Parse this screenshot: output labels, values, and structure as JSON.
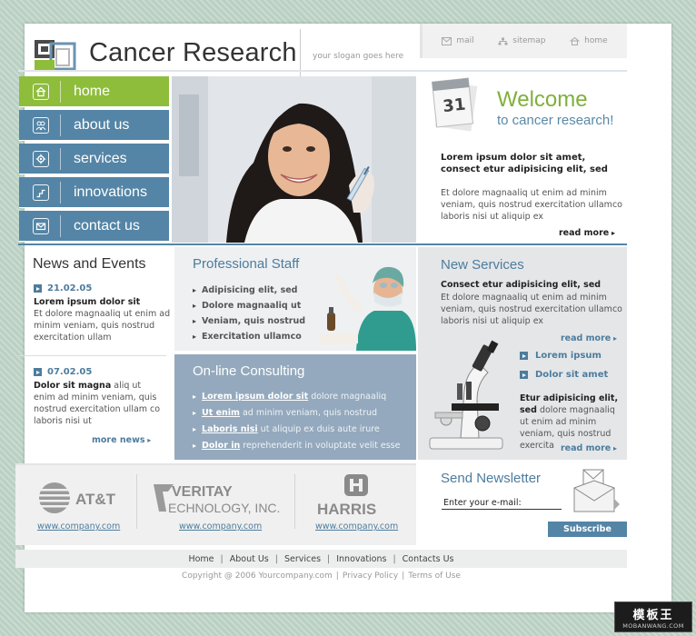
{
  "header": {
    "site_title": "Cancer Research",
    "slogan": "your slogan goes here",
    "top_links": [
      {
        "label": "mail",
        "icon": "envelope-icon"
      },
      {
        "label": "sitemap",
        "icon": "sitemap-icon"
      },
      {
        "label": "home",
        "icon": "home-icon"
      }
    ]
  },
  "nav": {
    "items": [
      {
        "label": "home",
        "icon": "home-icon",
        "active": true
      },
      {
        "label": "about us",
        "icon": "people-icon"
      },
      {
        "label": "services",
        "icon": "gear-icon"
      },
      {
        "label": "innovations",
        "icon": "stairs-icon"
      },
      {
        "label": "contact us",
        "icon": "envelope-icon"
      }
    ]
  },
  "welcome": {
    "calendar_day": "31",
    "title": "Welcome",
    "subtitle": "to cancer research!",
    "bold": "Lorem ipsum dolor sit amet, consect etur adipisicing elit, sed",
    "text": "Et dolore magnaaliq ut enim ad minim veniam, quis nostrud exercitation ullamco laboris nisi ut aliquip ex",
    "read_more": "read more"
  },
  "news": {
    "title": "News and Events",
    "items": [
      {
        "date": "21.02.05",
        "headline": "Lorem ipsum dolor sit",
        "text": "Et dolore magnaaliq ut enim ad minim veniam, quis nostrud exercitation ullam"
      },
      {
        "date": "07.02.05",
        "headline": "Dolor sit magna",
        "text_lead": "aliq ut",
        "text": "enim ad minim veniam, quis nostrud exercitation ullam co laboris nisi ut"
      }
    ],
    "more": "more news"
  },
  "staff": {
    "title": "Professional Staff",
    "items": [
      "Adipisicing elit, sed",
      "Dolore magnaaliq ut",
      "Veniam, quis nostrud",
      "Exercitation ullamco"
    ]
  },
  "consulting": {
    "title": "On-line Consulting",
    "items": [
      {
        "link": "Lorem ipsum dolor sit",
        "text": "dolore magnaaliq"
      },
      {
        "link": "Ut enim",
        "text": "ad minim veniam, quis nostrud"
      },
      {
        "link": "Laboris nisi",
        "text": "ut aliquip ex duis aute irure"
      },
      {
        "link": "Dolor in",
        "text": "reprehenderit in voluptate velit esse"
      }
    ]
  },
  "services": {
    "title": "New Services",
    "bold": "Consect etur adipisicing elit, sed",
    "text": "Et dolore magnaaliq ut enim ad minim veniam, quis nostrud exercitation ullamco laboris nisi ut aliquip ex",
    "read_more_1": "read more",
    "links": [
      "Lorem ipsum",
      "Dolor sit amet"
    ],
    "bottom_bold": "Etur adipisicing elit, sed",
    "bottom_text": "dolore magnaaliq ut enim ad minim veniam, quis nostrud exercita",
    "read_more_2": "read more"
  },
  "partners": [
    {
      "name": "AT&T",
      "url": "www.company.com"
    },
    {
      "name": "VERITAY",
      "name_sub": "ECHNOLOGY, INC.",
      "url": "www.company.com"
    },
    {
      "name": "HARRIS",
      "url": "www.company.com"
    }
  ],
  "newsletter": {
    "title": "Send Newsletter",
    "input_value": "Enter your e-mail:",
    "button": "Subscribe"
  },
  "footer": {
    "links": [
      "Home",
      "About Us",
      "Services",
      "Innovations",
      "Contacts Us"
    ],
    "copyright": "Copyright @ 2006 Yourcompany.com",
    "privacy": "Privacy Policy",
    "terms": "Terms of Use"
  },
  "watermark": {
    "top": "模板王",
    "bottom": "MOBANWANG.COM"
  },
  "colors": {
    "accent_green": "#8ebd3b",
    "accent_blue": "#5485a6",
    "link_blue": "#4d7c9d",
    "consult_panel": "#94a9bd"
  }
}
